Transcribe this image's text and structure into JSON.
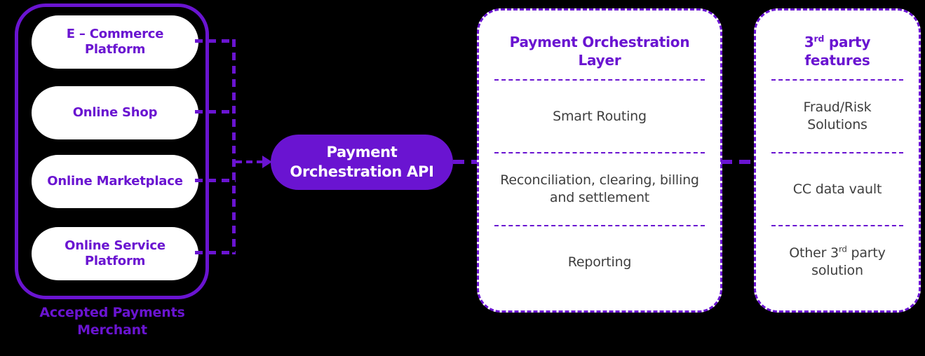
{
  "theme": {
    "background": "#000000",
    "accent": "#6A14D1",
    "card_background": "#FFFFFF",
    "body_text": "#3E3E3E",
    "pill_text": "#FFFFFF"
  },
  "merchant_group": {
    "caption": "Accepted Payments Merchant",
    "caption_line1": "Accepted Payments",
    "caption_line2": "Merchant",
    "items": [
      {
        "label": "E – Commerce Platform"
      },
      {
        "label": "Online Shop"
      },
      {
        "label": "Online Marketplace"
      },
      {
        "label": "Online Service Platform"
      }
    ]
  },
  "api_node": {
    "label": "Payment Orchestration API"
  },
  "orchestration_card": {
    "title": "Payment Orchestration Layer",
    "items": [
      "Smart Routing",
      "Reconciliation, clearing, billing and settlement",
      "Reporting"
    ]
  },
  "third_party_card": {
    "title_base": "3",
    "title_sup": "rd",
    "title_rest": " party features",
    "items": [
      {
        "text": "Fraud/Risk Solutions",
        "base": "Fraud/Risk Solutions",
        "sup": "",
        "rest": ""
      },
      {
        "text": "CC data vault",
        "base": "CC data vault",
        "sup": "",
        "rest": ""
      },
      {
        "text": "Other 3rd party solution",
        "base": "Other 3",
        "sup": "rd",
        "rest": " party solution"
      }
    ]
  },
  "connectors": {
    "merchant_bracket": "dashed-bracket",
    "arrow_to_api": "dashed-arrow-right",
    "api_to_layer": "dashed-segment",
    "layer_to_thirdparty": "dashed-segment"
  }
}
